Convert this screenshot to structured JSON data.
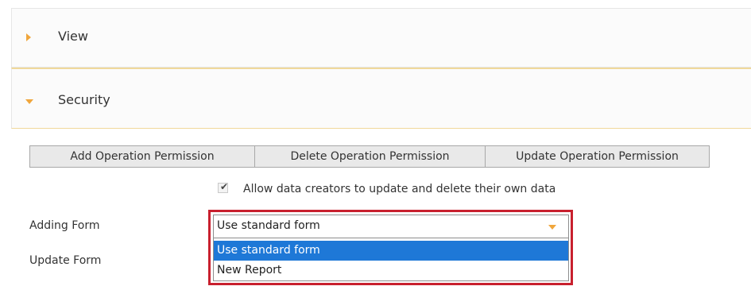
{
  "sections": {
    "view": {
      "title": "View",
      "expanded": false
    },
    "security": {
      "title": "Security",
      "expanded": true
    }
  },
  "operations": {
    "add_label": "Add Operation Permission",
    "delete_label": "Delete Operation Permission",
    "update_label": "Update Operation Permission"
  },
  "allow_creators": {
    "checked": true,
    "label": "Allow data creators to update and delete their own data"
  },
  "adding_form": {
    "label": "Adding Form",
    "value": "Use standard form",
    "options": [
      "Use standard form",
      "New Report"
    ],
    "selected_index": 0
  },
  "update_form": {
    "label": "Update Form"
  },
  "colors": {
    "accent": "#f0a63c",
    "highlight_border": "#c8202e",
    "selected_option": "#1e78d7"
  }
}
